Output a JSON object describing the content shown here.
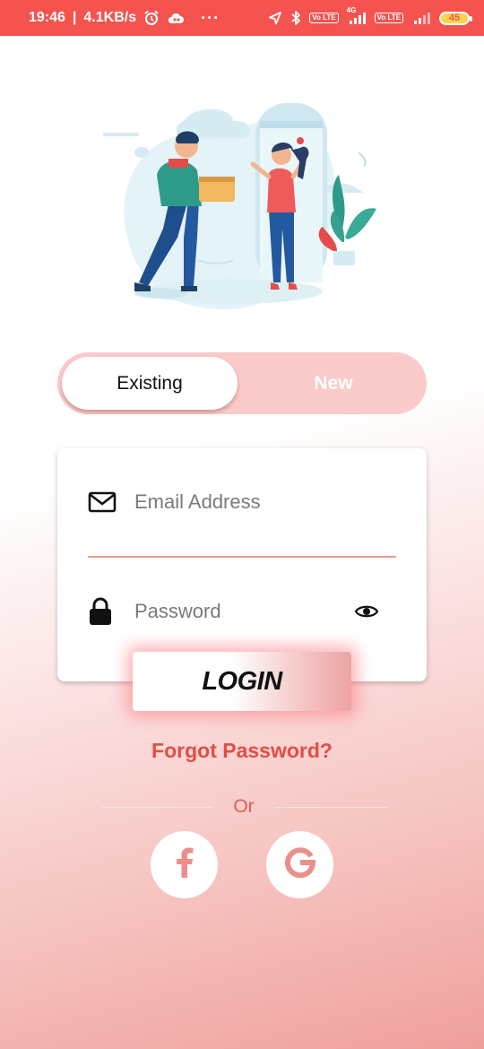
{
  "status_bar": {
    "time": "19:46",
    "network_speed": "4.1KB/s",
    "more": "···",
    "volte_1": "Vo LTE",
    "net_type": "4G",
    "volte_2": "Vo LTE",
    "battery": "45"
  },
  "auth_toggle": {
    "existing_label": "Existing",
    "new_label": "New",
    "selected": "Existing"
  },
  "form": {
    "email_placeholder": "Email Address",
    "email_value": "",
    "password_placeholder": "Password",
    "password_value": ""
  },
  "login_label": "LOGIN",
  "forgot_label": "Forgot Password?",
  "or_label": "Or",
  "social": {
    "facebook_letter": "f",
    "google_letter": "G"
  },
  "colors": {
    "status_bar": "#f4534f",
    "accent": "#e14e45",
    "toggle_bg": "#fbcaca",
    "underline": "#ec9d95"
  },
  "icons": [
    "alarm-icon",
    "cloud-icon",
    "location-icon",
    "bluetooth-icon",
    "signal-icon",
    "battery-icon",
    "mail-icon",
    "lock-icon",
    "eye-icon",
    "facebook-icon",
    "google-icon"
  ]
}
